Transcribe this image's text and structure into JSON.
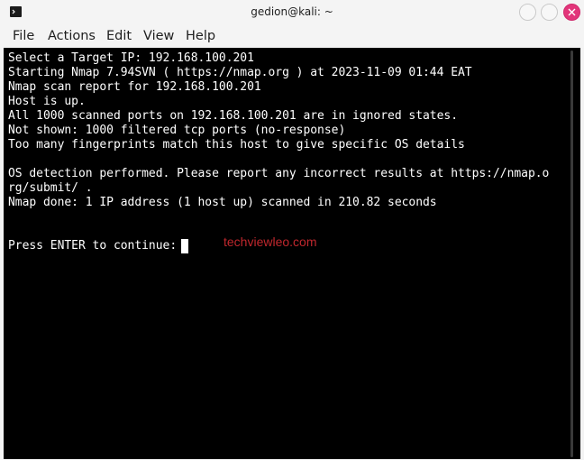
{
  "window": {
    "title": "gedion@kali: ~",
    "icon": "terminal-icon"
  },
  "menu": {
    "file": "File",
    "actions": "Actions",
    "edit": "Edit",
    "view": "View",
    "help": "Help"
  },
  "terminal": {
    "lines": [
      "Select a Target IP: 192.168.100.201",
      "Starting Nmap 7.94SVN ( https://nmap.org ) at 2023-11-09 01:44 EAT",
      "Nmap scan report for 192.168.100.201",
      "Host is up.",
      "All 1000 scanned ports on 192.168.100.201 are in ignored states.",
      "Not shown: 1000 filtered tcp ports (no-response)",
      "Too many fingerprints match this host to give specific OS details",
      "",
      "OS detection performed. Please report any incorrect results at https://nmap.o",
      "rg/submit/ .",
      "Nmap done: 1 IP address (1 host up) scanned in 210.82 seconds",
      "",
      "",
      "Press ENTER to continue:"
    ],
    "watermark": "techviewleo.com"
  },
  "colors": {
    "terminal_bg": "#000000",
    "terminal_fg": "#ffffff",
    "close_button": "#e2357a",
    "watermark": "#c0272d"
  }
}
